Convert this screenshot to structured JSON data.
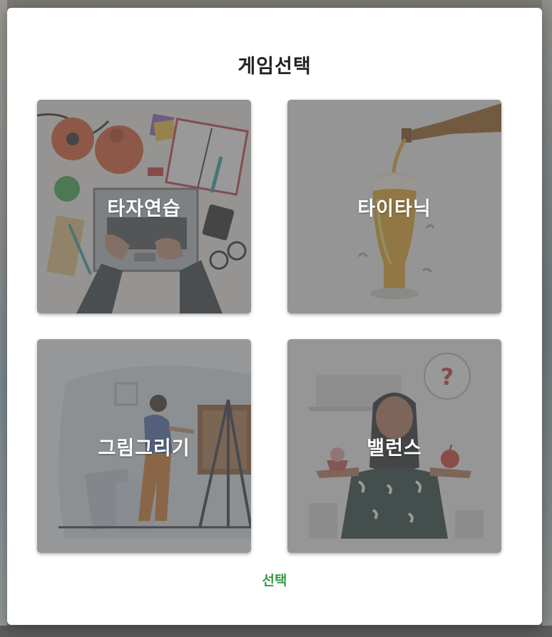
{
  "modal": {
    "title": "게임선택",
    "select_label": "선택"
  },
  "games": [
    {
      "label": "타자연습",
      "icon": "typing-practice-illustration"
    },
    {
      "label": "타이타닉",
      "icon": "beer-glass-illustration"
    },
    {
      "label": "그림그리기",
      "icon": "painter-illustration"
    },
    {
      "label": "밸런스",
      "icon": "balance-choice-illustration"
    }
  ],
  "colors": {
    "accent": "#3a9a46",
    "overlay": "#5a5a5a",
    "title": "#222222"
  }
}
